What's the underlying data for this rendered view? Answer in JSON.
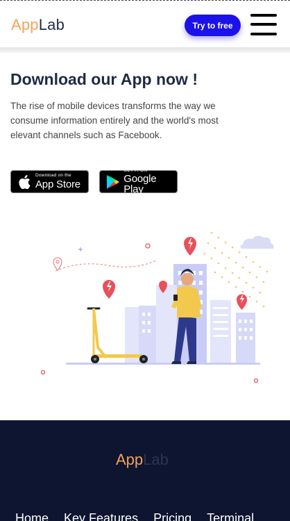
{
  "header": {
    "logo_app": "App",
    "logo_lab": "Lab",
    "cta_label": "Try to free"
  },
  "hero": {
    "title": "Download our App now !",
    "description": "The rise of mobile devices transforms the way we consume information entirely and the world's most elevant channels such as Facebook."
  },
  "stores": {
    "apple": {
      "small": "Download on the",
      "big": "App Store"
    },
    "google": {
      "small": "GET IT ON",
      "big": "Google Play"
    }
  },
  "footer": {
    "logo_app": "App",
    "logo_lab": "Lab",
    "nav": [
      "Home",
      "Key Features",
      "Pricing",
      "Terminal"
    ]
  },
  "colors": {
    "brand_orange": "#f4a259",
    "brand_navy": "#1f2a44",
    "cta_blue": "#1b12ea",
    "footer_bg": "#0d1530"
  },
  "icons": [
    "hamburger-menu-icon",
    "apple-icon",
    "google-play-icon",
    "location-pin-icon"
  ]
}
